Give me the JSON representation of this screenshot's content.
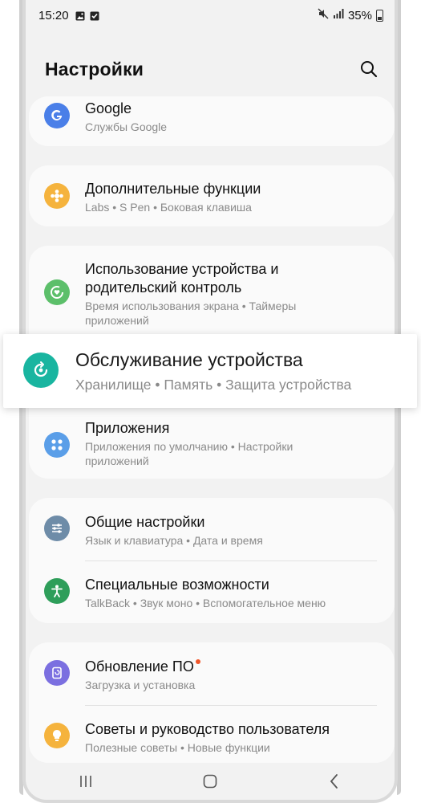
{
  "status_bar": {
    "time": "15:20",
    "battery": "35%",
    "icons": [
      "image-icon",
      "checkbox-icon",
      "mute-icon",
      "signal-icon",
      "battery-icon"
    ]
  },
  "header": {
    "title": "Настройки",
    "search_icon": "search-icon"
  },
  "items": [
    {
      "title": "Google",
      "subtitle": "Службы Google",
      "icon": "google-icon",
      "color": "#4a7fe8"
    },
    {
      "title": "Дополнительные функции",
      "subtitle": "Labs  •  S Pen  •  Боковая клавиша",
      "icon": "puzzle-icon",
      "color": "#f5b33d"
    },
    {
      "title_line1": "Использование устройства и",
      "title_line2": "родительский контроль",
      "subtitle_line1": "Время использования экрана  •  Таймеры",
      "subtitle_line2": "приложений",
      "icon": "digital-wellbeing-icon",
      "color": "#5cbf6a"
    },
    {
      "title": "Обслуживание устройства",
      "subtitle": "Хранилище  •  Память  •  Защита устройства",
      "icon": "device-care-icon",
      "color": "#19b5a0",
      "highlighted": true
    },
    {
      "title": "Приложения",
      "subtitle_line1": "Приложения по умолчанию  •  Настройки",
      "subtitle_line2": "приложений",
      "icon": "apps-icon",
      "color": "#5a9ee8"
    },
    {
      "title": "Общие настройки",
      "subtitle": "Язык и клавиатура  •  Дата и время",
      "icon": "sliders-icon",
      "color": "#6e8ca8"
    },
    {
      "title": "Специальные возможности",
      "subtitle": "TalkBack  •  Звук моно  •  Вспомогательное меню",
      "icon": "accessibility-icon",
      "color": "#2e9e5a"
    },
    {
      "title": "Обновление ПО",
      "subtitle": "Загрузка и установка",
      "icon": "software-update-icon",
      "color": "#7b6fe0",
      "badge": true
    },
    {
      "title": "Советы и руководство пользователя",
      "subtitle": "Полезные советы  •  Новые функции",
      "icon": "tips-icon",
      "color": "#f5b33d"
    }
  ],
  "nav": {
    "recent": "recent-apps-icon",
    "home": "home-icon",
    "back": "back-icon"
  }
}
